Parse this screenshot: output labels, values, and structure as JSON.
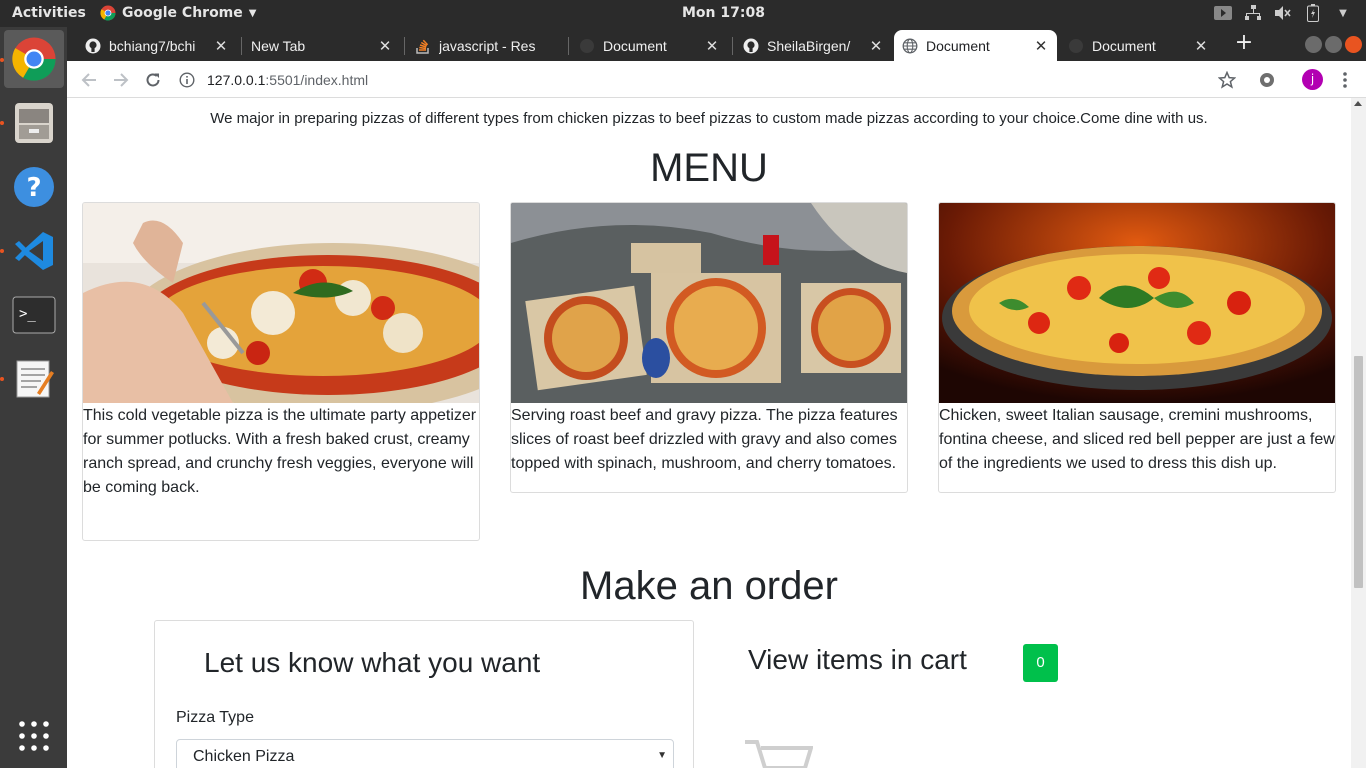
{
  "system": {
    "activities": "Activities",
    "app_name": "Google Chrome",
    "clock": "Mon 17:08"
  },
  "browser": {
    "tabs": [
      {
        "title": "bchiang7/bchi",
        "icon": "github-icon",
        "active": false
      },
      {
        "title": "New Tab",
        "icon": "none",
        "active": false
      },
      {
        "title": "javascript - Res",
        "icon": "stackoverflow-icon",
        "active": false
      },
      {
        "title": "Document",
        "icon": "globe-icon",
        "active": false
      },
      {
        "title": "SheilaBirgen/",
        "icon": "github-icon",
        "active": false
      },
      {
        "title": "Document",
        "icon": "globe-icon",
        "active": true
      },
      {
        "title": "Document",
        "icon": "globe-icon",
        "active": false
      }
    ],
    "url_host": "127.0.0.1",
    "url_rest": ":5501/index.html",
    "avatar_letter": "j",
    "colors": {
      "avatar": "#b200b2",
      "tabstrip": "#2b2b2b"
    }
  },
  "page": {
    "intro": "We major in preparing pizzas of different types from chicken pizzas to beef pizzas to custom made pizzas according to your choice.Come dine with us.",
    "menu_title": "MENU",
    "cards": [
      {
        "description": "This cold vegetable pizza is the ultimate party appetizer for summer potlucks. With a fresh baked crust, creamy ranch spread, and crunchy fresh veggies, everyone will be coming back."
      },
      {
        "description": "Serving roast beef and gravy pizza. The pizza features slices of roast beef drizzled with gravy and also comes topped with spinach, mushroom, and cherry tomatoes."
      },
      {
        "description": "Chicken, sweet Italian sausage, cremini mushrooms, fontina cheese, and sliced red bell pepper are just a few of the ingredients we used to dress this dish up."
      }
    ],
    "order_title": "Make an order",
    "form": {
      "heading": "Let us know what you want",
      "pizza_type_label": "Pizza Type",
      "pizza_type_value": "Chicken Pizza"
    },
    "cart": {
      "heading": "View items in cart",
      "count": "0",
      "badge_color": "#00c04b"
    }
  }
}
